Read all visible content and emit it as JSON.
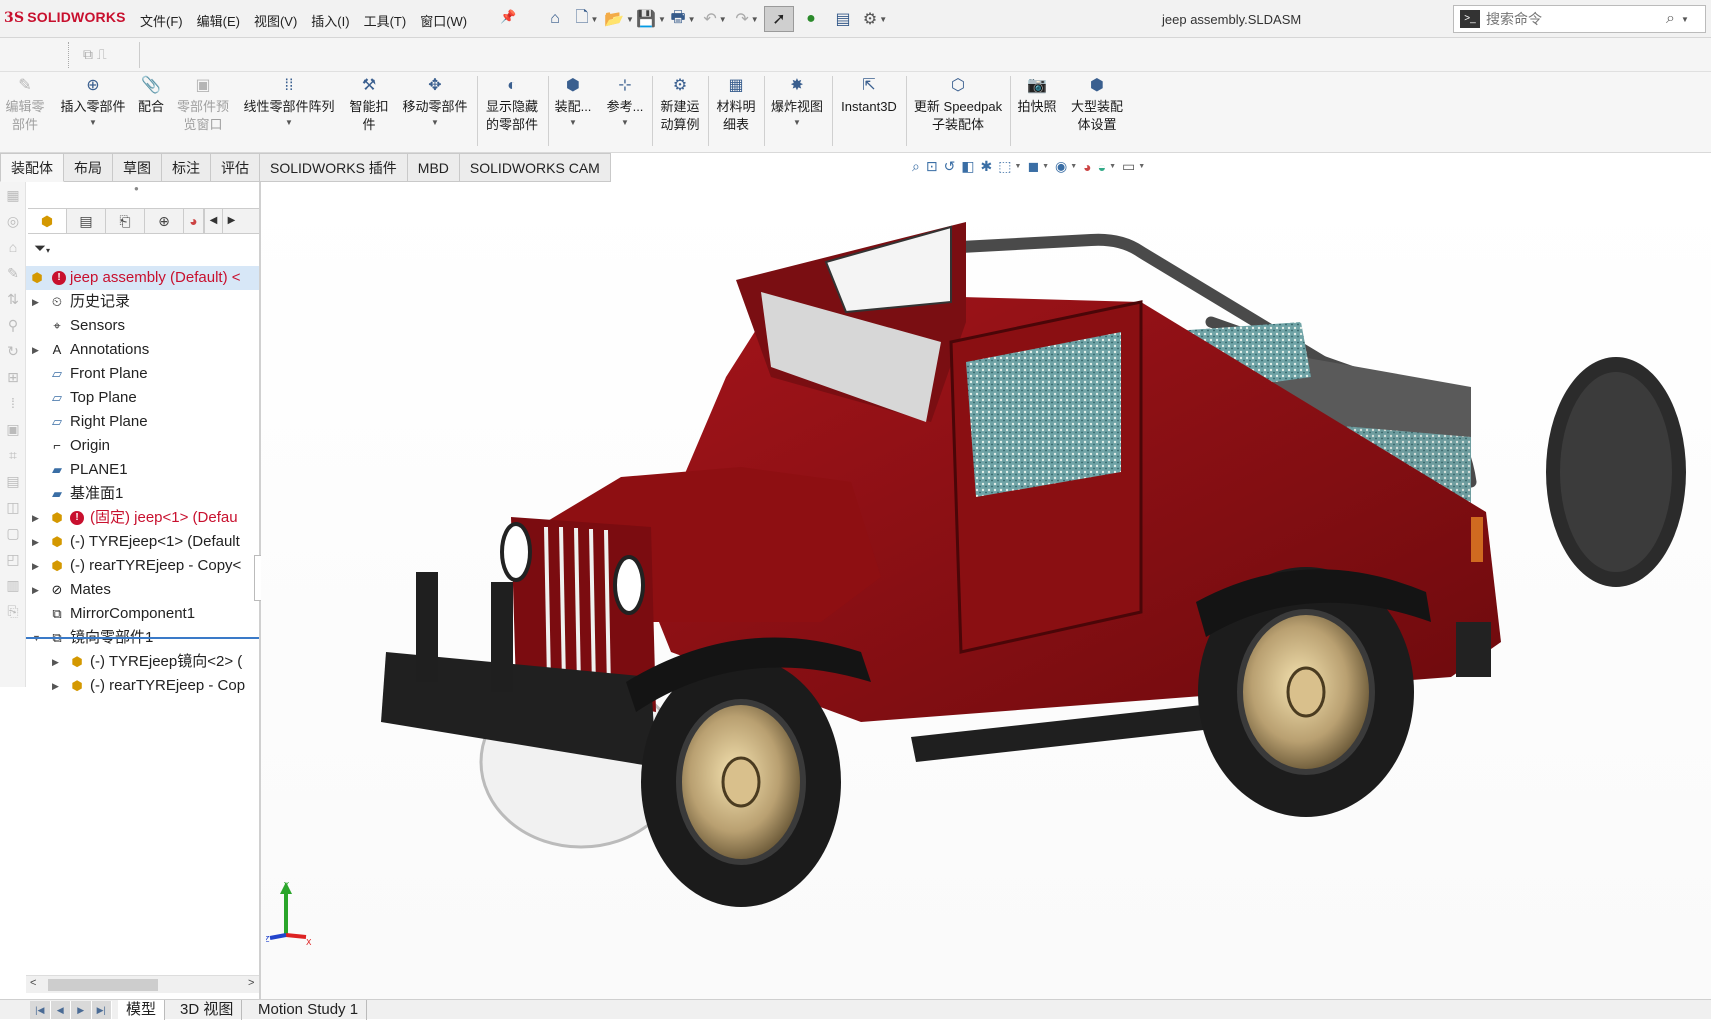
{
  "app": {
    "brand": "SOLIDWORKS",
    "brand_prefix": "3S",
    "document_title": "jeep assembly.SLDASM"
  },
  "menus": [
    "文件(F)",
    "编辑(E)",
    "视图(V)",
    "插入(I)",
    "工具(T)",
    "窗口(W)"
  ],
  "quick_toolbar": [
    "home-icon",
    "new-document-icon",
    "open-icon",
    "save-icon",
    "print-icon",
    "undo-icon",
    "redo-icon",
    "select-pointer-icon",
    "rebuild-traffic-light-icon",
    "file-properties-icon",
    "options-gear-icon"
  ],
  "search": {
    "placeholder": "搜索命令"
  },
  "commands": [
    {
      "label": "编辑零\n部件",
      "disabled": true
    },
    {
      "label": "插入零部件",
      "disabled": false
    },
    {
      "label": "配合",
      "disabled": false
    },
    {
      "label": "零部件预\n览窗口",
      "disabled": true
    },
    {
      "label": "线性零部件阵列",
      "disabled": false
    },
    {
      "label": "智能扣\n件",
      "disabled": false
    },
    {
      "label": "移动零部件",
      "disabled": false
    },
    {
      "label": "显示隐藏\n的零部件",
      "disabled": false
    },
    {
      "label": "装配...",
      "disabled": false
    },
    {
      "label": "参考...",
      "disabled": false
    },
    {
      "label": "新建运\n动算例",
      "disabled": false
    },
    {
      "label": "材料明\n细表",
      "disabled": false
    },
    {
      "label": "爆炸视图",
      "disabled": false
    },
    {
      "label": "Instant3D",
      "disabled": false
    },
    {
      "label": "更新 Speedpak\n子装配体",
      "disabled": false
    },
    {
      "label": "拍快照",
      "disabled": false
    },
    {
      "label": "大型装配\n体设置",
      "disabled": false
    }
  ],
  "tabs": [
    "装配体",
    "布局",
    "草图",
    "标注",
    "评估",
    "SOLIDWORKS 插件",
    "MBD",
    "SOLIDWORKS CAM"
  ],
  "active_tab": "装配体",
  "tree": {
    "root": "jeep assembly  (Default) <",
    "items": [
      {
        "label": "历史记录",
        "icon": "history-icon",
        "expandable": true
      },
      {
        "label": "Sensors",
        "icon": "sensors-icon",
        "expandable": false
      },
      {
        "label": "Annotations",
        "icon": "annotations-icon",
        "expandable": true
      },
      {
        "label": "Front Plane",
        "icon": "plane-icon",
        "expandable": false
      },
      {
        "label": "Top Plane",
        "icon": "plane-icon",
        "expandable": false
      },
      {
        "label": "Right Plane",
        "icon": "plane-icon",
        "expandable": false
      },
      {
        "label": "Origin",
        "icon": "origin-icon",
        "expandable": false
      },
      {
        "label": "PLANE1",
        "icon": "ref-plane-icon",
        "expandable": false
      },
      {
        "label": "基准面1",
        "icon": "ref-plane-icon",
        "expandable": false
      },
      {
        "label": "(固定) jeep<1> (Defau",
        "icon": "part-icon",
        "expandable": true,
        "error": true
      },
      {
        "label": "(-) TYREjeep<1> (Default",
        "icon": "part-icon",
        "expandable": true
      },
      {
        "label": "(-) rearTYREjeep - Copy<",
        "icon": "part-icon",
        "expandable": true
      },
      {
        "label": "Mates",
        "icon": "mates-icon",
        "expandable": true
      },
      {
        "label": "MirrorComponent1",
        "icon": "mirror-icon",
        "expandable": false
      },
      {
        "label": "镜向零部件1",
        "icon": "mirror-icon",
        "expandable": true,
        "expanded": true
      },
      {
        "label": "(-) TYREjeep镜向<2> (",
        "icon": "part-icon",
        "expandable": true,
        "indent": 1
      },
      {
        "label": "(-) rearTYREjeep - Cop",
        "icon": "part-icon",
        "expandable": true,
        "indent": 1
      }
    ]
  },
  "bottom_tabs": [
    "模型",
    "3D 视图",
    "Motion Study 1"
  ],
  "colors": {
    "brand_red": "#c8102e",
    "body_red": "#8e0f12",
    "accent_blue": "#3a6ea5"
  }
}
